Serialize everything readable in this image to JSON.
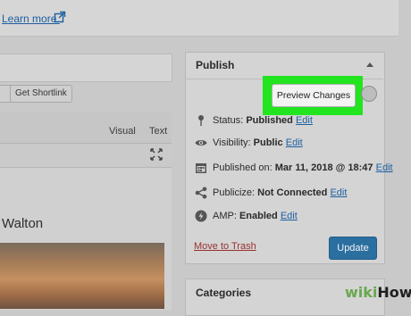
{
  "notice": {
    "learn_more": "Learn more."
  },
  "permalink": {
    "get_shortlink": "Get Shortlink"
  },
  "editor": {
    "tabs": {
      "visual": "Visual",
      "text": "Text"
    },
    "content_snippet": "Walton"
  },
  "publish": {
    "title": "Publish",
    "preview_button": "Preview Changes",
    "status": {
      "label": "Status:",
      "value": "Published",
      "edit": "Edit"
    },
    "visibility": {
      "label": "Visibility:",
      "value": "Public",
      "edit": "Edit"
    },
    "published_on": {
      "label": "Published on:",
      "value": "Mar 11, 2018 @ 18:47",
      "edit": "Edit"
    },
    "publicize": {
      "label": "Publicize:",
      "value": "Not Connected",
      "edit": "Edit"
    },
    "amp": {
      "label": "AMP:",
      "value": "Enabled",
      "edit": "Edit"
    },
    "move_to_trash": "Move to Trash",
    "update_button": "Update"
  },
  "categories": {
    "title": "Categories"
  },
  "watermark": {
    "part1": "wiki",
    "part2": "How"
  },
  "colors": {
    "highlight": "#22e41f",
    "primary_button": "#2b6fa1",
    "link": "#1d5fa0",
    "trash": "#9a3030"
  },
  "icons": [
    "external-link-icon",
    "fullscreen-icon",
    "pin-icon",
    "eye-icon",
    "calendar-icon",
    "share-icon",
    "bolt-icon",
    "help-icon",
    "collapse-caret-icon"
  ]
}
